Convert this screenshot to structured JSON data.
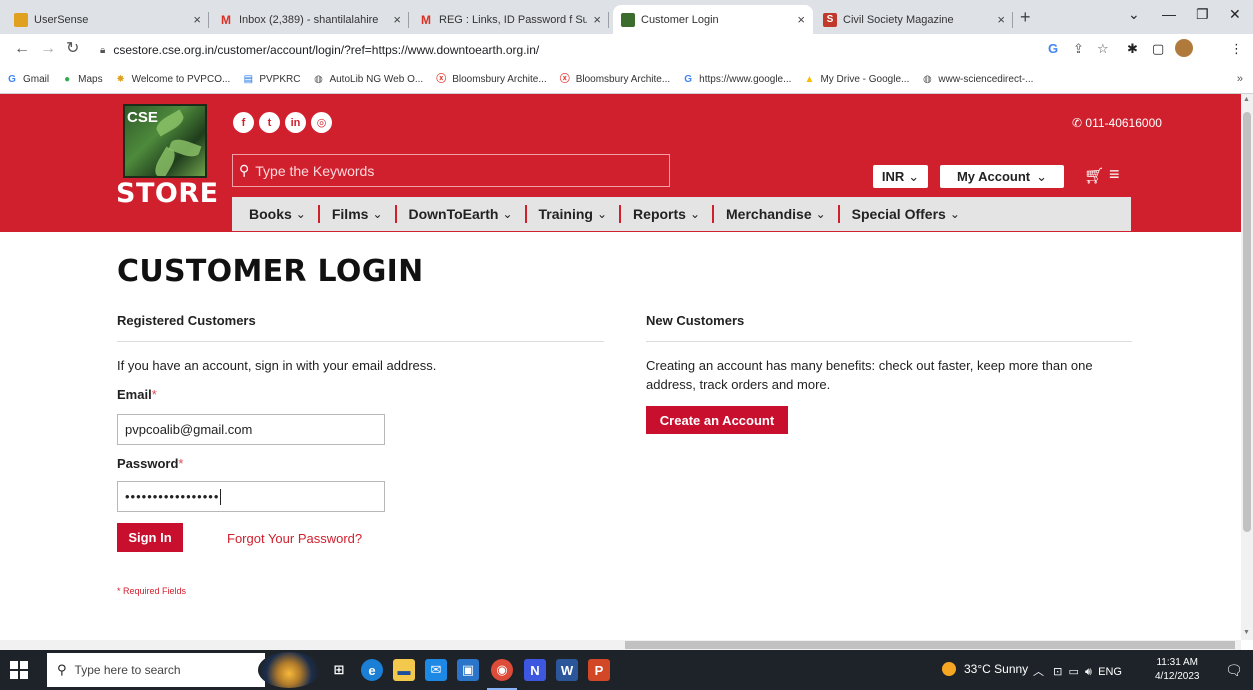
{
  "browser": {
    "tabs": [
      {
        "title": "UserSense",
        "favicon_color": "#e0a020"
      },
      {
        "title": "Inbox (2,389) - shantilalahire",
        "favicon_color": "#d93025",
        "favicon": "M"
      },
      {
        "title": "REG : Links, ID Password f Sul",
        "favicon_color": "#d93025",
        "favicon": "M"
      },
      {
        "title": "Customer Login",
        "favicon_color": "#3c6d2c"
      },
      {
        "title": "Civil Society Magazine",
        "favicon_color": "#c0392b",
        "favicon": "S"
      }
    ],
    "close_glyph": "×",
    "new_tab_glyph": "+",
    "url": "csestore.cse.org.in/customer/account/login/?ref=https://www.downtoearth.org.in/",
    "bookmarks": [
      {
        "label": "Gmail",
        "icon": "G",
        "color": "#4285f4"
      },
      {
        "label": "Maps",
        "icon": "●",
        "color": "#34a853"
      },
      {
        "label": "Welcome to PVPCO...",
        "icon": "✸",
        "color": "#e0a020"
      },
      {
        "label": "PVPKRC",
        "icon": "▤",
        "color": "#1a73e8"
      },
      {
        "label": "AutoLib NG Web O...",
        "icon": "◍",
        "color": "#555555"
      },
      {
        "label": "Bloomsbury Archite...",
        "icon": "ⓧ",
        "color": "#e8453c"
      },
      {
        "label": "Bloomsbury Archite...",
        "icon": "ⓧ",
        "color": "#e8453c"
      },
      {
        "label": "https://www.google...",
        "icon": "G",
        "color": "#4285f4"
      },
      {
        "label": "My Drive - Google...",
        "icon": "▲",
        "color": "#fbbc04"
      },
      {
        "label": "www-sciencedirect-...",
        "icon": "◍",
        "color": "#555555"
      }
    ],
    "bookmarks_more": "»"
  },
  "site": {
    "logo_letters": "CSE",
    "logo_word": "STORE",
    "socials": [
      "f",
      "t",
      "in",
      "◎"
    ],
    "phone": "011-40616000",
    "search_placeholder": "Type the Keywords",
    "currency": "INR",
    "account_label": "My Account",
    "nav": [
      "Books",
      "Films",
      "DownToEarth",
      "Training",
      "Reports",
      "Merchandise",
      "Special Offers"
    ],
    "accent": "#d0202e"
  },
  "login": {
    "title": "CUSTOMER LOGIN",
    "registered": {
      "heading": "Registered Customers",
      "intro": "If you have an account, sign in with your email address.",
      "email_label": "Email",
      "email_value": "pvpcoalib@gmail.com",
      "password_label": "Password",
      "password_value": "•••••••••••••••••",
      "required_mark": "*",
      "sign_in": "Sign In",
      "forgot": "Forgot Your Password?",
      "required_note": "* Required Fields"
    },
    "new": {
      "heading": "New Customers",
      "text": "Creating an account has many benefits: check out faster, keep more than one address, track orders and more.",
      "create": "Create an Account"
    }
  },
  "taskbar": {
    "search_placeholder": "Type here to search",
    "weather": "33°C  Sunny",
    "lang": "ENG",
    "time": "11:31 AM",
    "date": "4/12/2023"
  }
}
